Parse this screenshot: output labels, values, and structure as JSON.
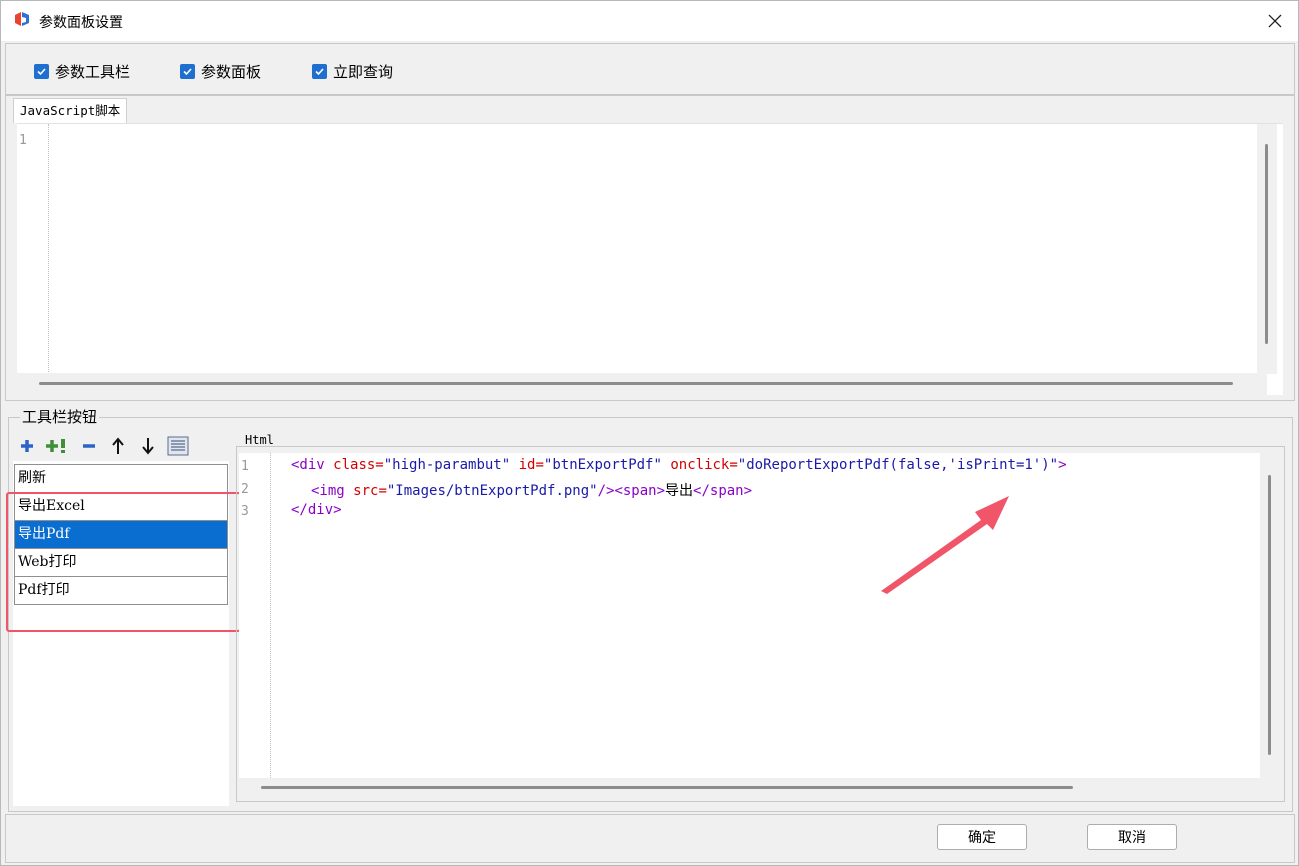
{
  "window": {
    "title": "参数面板设置",
    "icon": "app-logo-icon",
    "close_icon": "close-icon"
  },
  "options": [
    {
      "label": "参数工具栏",
      "checked": true
    },
    {
      "label": "参数面板",
      "checked": true
    },
    {
      "label": "立即查询",
      "checked": true
    }
  ],
  "js_tab": {
    "label": "JavaScript脚本",
    "line_numbers": [
      "1"
    ],
    "content": ""
  },
  "toolbar_group": {
    "label": "工具栏按钮",
    "tools": [
      "add-icon",
      "add-special-icon",
      "remove-icon",
      "move-up-icon",
      "move-down-icon",
      "list-icon"
    ],
    "items": [
      {
        "label": "刷新",
        "selected": false
      },
      {
        "label": "导出Excel",
        "selected": false
      },
      {
        "label": "导出Pdf",
        "selected": true
      },
      {
        "label": "Web打印",
        "selected": false
      },
      {
        "label": "Pdf打印",
        "selected": false
      }
    ]
  },
  "html_editor": {
    "label": "Html",
    "line_numbers": [
      "1",
      "2",
      "3"
    ],
    "line1": {
      "open": "<div",
      "attr1": "class=",
      "val1": "\"high-parambut\"",
      "attr2": "id=",
      "val2": "\"btnExportPdf\"",
      "attr3": "onclick=",
      "val3": "\"doReportExportPdf(false,'isPrint=1')\"",
      "close": ">"
    },
    "line2": {
      "open": "<img",
      "attr1": "src=",
      "val1": "\"Images/btnExportPdf.png\"",
      "close": "/>",
      "span_open": "<span>",
      "text": "导出",
      "span_close": "</span>"
    },
    "line3": {
      "close_tag": "</div>"
    }
  },
  "footer": {
    "ok_label": "确定",
    "cancel_label": "取消"
  },
  "colors": {
    "accent": "#0a6ed1",
    "highlight": "#f0556a",
    "arrow": "#f0556a"
  }
}
